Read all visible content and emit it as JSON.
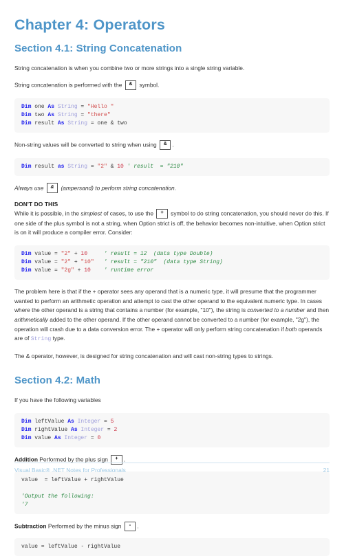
{
  "chapter": {
    "title": "Chapter 4: Operators"
  },
  "sections": [
    {
      "heading": "Section 4.1: String Concatenation",
      "p1": "String concatenation is when you combine two or more strings into a single string variable.",
      "p2_before": "String concatenation is performed with the",
      "p2_kbd": "&",
      "p2_after": "symbol.",
      "code1": {
        "lines": [
          [
            {
              "t": "Dim ",
              "c": "k"
            },
            {
              "t": "one ",
              "c": "pl"
            },
            {
              "t": "As ",
              "c": "k"
            },
            {
              "t": "String",
              "c": "t"
            },
            {
              "t": " = ",
              "c": "pl"
            },
            {
              "t": "\"Hello \"",
              "c": "s"
            }
          ],
          [
            {
              "t": "Dim ",
              "c": "k"
            },
            {
              "t": "two ",
              "c": "pl"
            },
            {
              "t": "As ",
              "c": "k"
            },
            {
              "t": "String",
              "c": "t"
            },
            {
              "t": " = ",
              "c": "pl"
            },
            {
              "t": "\"there\"",
              "c": "s"
            }
          ],
          [
            {
              "t": "Dim ",
              "c": "k"
            },
            {
              "t": "result ",
              "c": "pl"
            },
            {
              "t": "As ",
              "c": "k"
            },
            {
              "t": "String",
              "c": "t"
            },
            {
              "t": " = one & two",
              "c": "pl"
            }
          ]
        ]
      },
      "p3_before": "Non-string values will be converted to string when using",
      "p3_kbd": "&",
      "p3_after": ".",
      "code2": {
        "lines": [
          [
            {
              "t": "Dim ",
              "c": "k"
            },
            {
              "t": "result ",
              "c": "pl"
            },
            {
              "t": "as ",
              "c": "k"
            },
            {
              "t": "String",
              "c": "t"
            },
            {
              "t": " = ",
              "c": "pl"
            },
            {
              "t": "\"2\"",
              "c": "s"
            },
            {
              "t": " & ",
              "c": "pl"
            },
            {
              "t": "10",
              "c": "n"
            },
            {
              "t": " ",
              "c": "pl"
            },
            {
              "t": "' result  = \"210\"",
              "c": "c"
            }
          ]
        ]
      },
      "p4_before": "Always use",
      "p4_kbd": "&",
      "p4_after": "(ampersand) to perform string concatenation.",
      "dont_heading": "DON'T DO THIS",
      "p5_a": "While it is possible, in the",
      "p5_i": "simplest",
      "p5_b": "of cases, to use the",
      "p5_kbd": "+",
      "p5_c": "symbol to do string concatenation, you should never do this. If one side of the plus symbol is not a string, when Option strict is off, the behavior becomes non-intuitive, when Option strict is on it will produce a compiler error. Consider:",
      "code3": {
        "lines": [
          [
            {
              "t": "Dim ",
              "c": "k"
            },
            {
              "t": "value = ",
              "c": "pl"
            },
            {
              "t": "\"2\"",
              "c": "s"
            },
            {
              "t": " + ",
              "c": "pl"
            },
            {
              "t": "10",
              "c": "n"
            },
            {
              "t": "     ",
              "c": "pl"
            },
            {
              "t": "' result = 12  (data type Double)",
              "c": "c"
            }
          ],
          [
            {
              "t": "Dim ",
              "c": "k"
            },
            {
              "t": "value = ",
              "c": "pl"
            },
            {
              "t": "\"2\"",
              "c": "s"
            },
            {
              "t": " + ",
              "c": "pl"
            },
            {
              "t": "\"10\"",
              "c": "s"
            },
            {
              "t": "   ",
              "c": "pl"
            },
            {
              "t": "' result = \"210\"  (data type String)",
              "c": "c"
            }
          ],
          [
            {
              "t": "Dim ",
              "c": "k"
            },
            {
              "t": "value = ",
              "c": "pl"
            },
            {
              "t": "\"2g\"",
              "c": "s"
            },
            {
              "t": " + ",
              "c": "pl"
            },
            {
              "t": "10",
              "c": "n"
            },
            {
              "t": "    ",
              "c": "pl"
            },
            {
              "t": "' runtime error",
              "c": "c"
            }
          ]
        ]
      },
      "p6_a": "The problem here is that if the + operator sees any operand that is a numeric type, it will presume that the programmer wanted to perform an arithmetic operation and attempt to cast the other operand to the equivalent numeric type. In cases where the other operand is a string that contains a number (for example, \"10\"), the string is",
      "p6_i1": "converted to a number",
      "p6_b": "and then",
      "p6_i2": "arithmetically",
      "p6_c": "added to the other operand. If the other operand cannot be converted to a number (for example, \"2g\"), the operation will crash due to a data conversion error. The + operator will only perform string concatenation if",
      "p6_i3": "both",
      "p6_d": "operands are of",
      "p6_code": "String",
      "p6_e": "type.",
      "p7": "The & operator, however, is designed for string concatenation and will cast non-string types to strings."
    },
    {
      "heading": "Section 4.2: Math",
      "p1": "If you have the following variables",
      "code1": {
        "lines": [
          [
            {
              "t": "Dim ",
              "c": "k"
            },
            {
              "t": "leftValue ",
              "c": "pl"
            },
            {
              "t": "As ",
              "c": "k"
            },
            {
              "t": "Integer",
              "c": "t"
            },
            {
              "t": " = ",
              "c": "pl"
            },
            {
              "t": "5",
              "c": "n"
            }
          ],
          [
            {
              "t": "Dim ",
              "c": "k"
            },
            {
              "t": "rightValue ",
              "c": "pl"
            },
            {
              "t": "As ",
              "c": "k"
            },
            {
              "t": "Integer",
              "c": "t"
            },
            {
              "t": " = ",
              "c": "pl"
            },
            {
              "t": "2",
              "c": "n"
            }
          ],
          [
            {
              "t": "Dim ",
              "c": "k"
            },
            {
              "t": "value ",
              "c": "pl"
            },
            {
              "t": "As ",
              "c": "k"
            },
            {
              "t": "Integer",
              "c": "t"
            },
            {
              "t": " = ",
              "c": "pl"
            },
            {
              "t": "0",
              "c": "n"
            }
          ]
        ]
      },
      "add_bold": "Addition",
      "add_text": "Performed by the plus sign",
      "add_kbd": "+",
      "add_after": ".",
      "code2": {
        "lines": [
          [
            {
              "t": "value  = leftValue + rightValue",
              "c": "pl"
            }
          ],
          [
            {
              "t": "",
              "c": "pl"
            }
          ],
          [
            {
              "t": "'Output the following:",
              "c": "c"
            }
          ],
          [
            {
              "t": "'7",
              "c": "c"
            }
          ]
        ]
      },
      "sub_bold": "Subtraction",
      "sub_text": "Performed by the minus sign",
      "sub_kbd": "-",
      "sub_after": ".",
      "code3": {
        "lines": [
          [
            {
              "t": "value = leftValue - rightValue",
              "c": "pl"
            }
          ]
        ]
      }
    }
  ],
  "footer": {
    "left": "Visual Basic® .NET Notes for Professionals",
    "page": "21"
  },
  "colors": {
    "heading_blue": "#4e95c8",
    "footer_blue": "#9ec8e3",
    "code_bg": "#f7f7f7",
    "keyword": "#1a1aee",
    "type": "#9d9ddb",
    "string": "#d14b4b",
    "comment": "#2e8b45"
  }
}
